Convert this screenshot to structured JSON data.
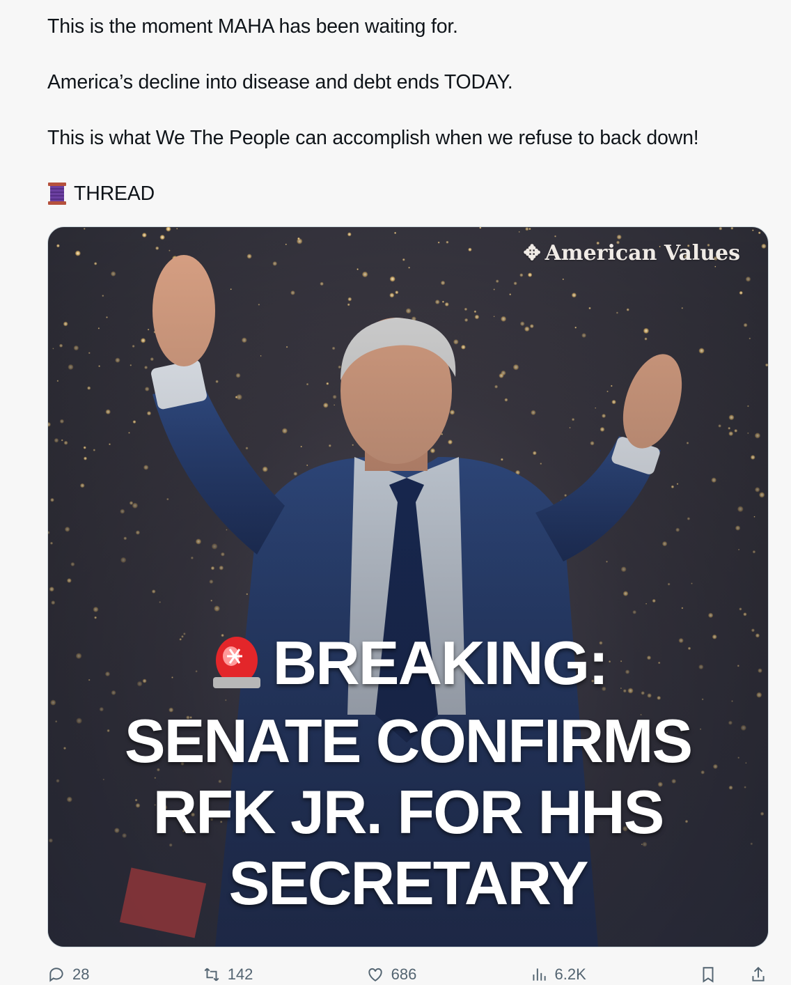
{
  "tweet": {
    "lines": [
      "This is the moment MAHA has been waiting for.",
      "America’s decline into disease and debt ends TODAY.",
      "This is what We The People can accomplish when we refuse to back down!",
      "THREAD"
    ],
    "thread_emoji": "thread-spool-icon"
  },
  "media": {
    "watermark": "American Values",
    "headline": [
      "BREAKING:",
      "SENATE CONFIRMS",
      "RFK JR. FOR HHS",
      "SECRETARY"
    ],
    "headline_emoji": "rotating-light-icon",
    "photo_description_icon": "person-raising-hands-image"
  },
  "actions": {
    "reply_count": "28",
    "repost_count": "142",
    "like_count": "686",
    "views_count": "6.2K"
  },
  "colors": {
    "text": "#0f1419",
    "muted": "#536471",
    "background": "#f7f7f7"
  }
}
